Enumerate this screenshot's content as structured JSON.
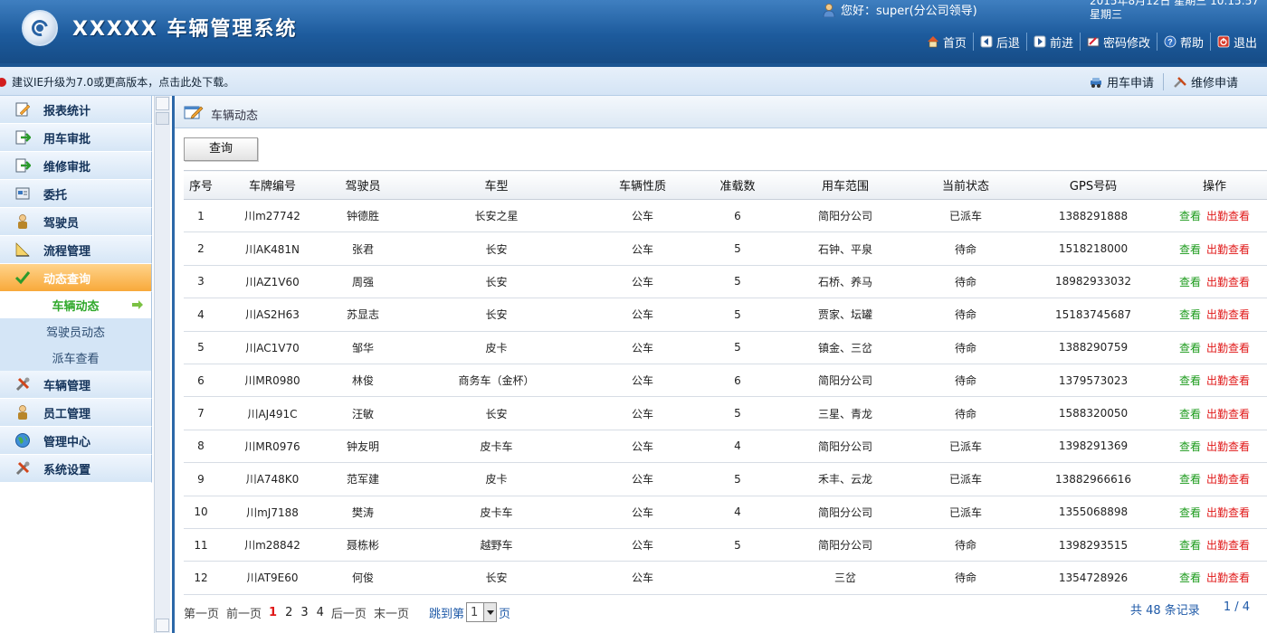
{
  "header": {
    "title": "XXXXX 车辆管理系统",
    "greeting": "您好：super(分公司领导)",
    "datetime_line1": "2015年8月12日 星期三 10:15:57",
    "datetime_line2": "星期三",
    "nav": [
      {
        "label": "首页",
        "icon": "home-icon"
      },
      {
        "label": "后退",
        "icon": "back-icon"
      },
      {
        "label": "前进",
        "icon": "forward-icon"
      },
      {
        "label": "密码修改",
        "icon": "password-icon"
      },
      {
        "label": "帮助",
        "icon": "help-icon"
      },
      {
        "label": "退出",
        "icon": "logout-icon"
      }
    ]
  },
  "notice": {
    "text": "建议IE升级为7.0或更高版本，点击此处下载。",
    "quick_links": [
      {
        "label": "用车申请",
        "icon": "car-apply-icon"
      },
      {
        "label": "维修申请",
        "icon": "repair-apply-icon"
      }
    ]
  },
  "sidebar": {
    "items": [
      {
        "label": "报表统计",
        "icon": "report-icon"
      },
      {
        "label": "用车审批",
        "icon": "approve-icon"
      },
      {
        "label": "维修审批",
        "icon": "approve-icon"
      },
      {
        "label": "委托",
        "icon": "delegate-icon"
      },
      {
        "label": "驾驶员",
        "icon": "driver-icon"
      },
      {
        "label": "流程管理",
        "icon": "flow-icon"
      },
      {
        "label": "动态查询",
        "icon": "check-icon"
      },
      {
        "label": "车辆管理",
        "icon": "tools-icon"
      },
      {
        "label": "员工管理",
        "icon": "driver-icon"
      },
      {
        "label": "管理中心",
        "icon": "globe-icon"
      },
      {
        "label": "系统设置",
        "icon": "tools-icon"
      }
    ],
    "sub_items": [
      {
        "label": "车辆动态"
      },
      {
        "label": "驾驶员动态"
      },
      {
        "label": "派车查看"
      }
    ]
  },
  "content": {
    "breadcrumb": "车辆动态",
    "query_button": "查询",
    "columns": [
      "序号",
      "车牌编号",
      "驾驶员",
      "车型",
      "车辆性质",
      "准载数",
      "用车范围",
      "当前状态",
      "GPS号码",
      "操作"
    ],
    "rows": [
      {
        "no": "1",
        "plate": "川m27742",
        "driver": "钟德胜",
        "model": "长安之星",
        "nature": "公车",
        "seats": "6",
        "scope": "简阳分公司",
        "status": "已派车",
        "gps": "1388291888"
      },
      {
        "no": "2",
        "plate": "川AK481N",
        "driver": "张君",
        "model": "长安",
        "nature": "公车",
        "seats": "5",
        "scope": "石钟、平泉",
        "status": "待命",
        "gps": "1518218000"
      },
      {
        "no": "3",
        "plate": "川AZ1V60",
        "driver": "周强",
        "model": "长安",
        "nature": "公车",
        "seats": "5",
        "scope": "石桥、养马",
        "status": "待命",
        "gps": "18982933032"
      },
      {
        "no": "4",
        "plate": "川AS2H63",
        "driver": "苏显志",
        "model": "长安",
        "nature": "公车",
        "seats": "5",
        "scope": "贾家、坛罐",
        "status": "待命",
        "gps": "15183745687"
      },
      {
        "no": "5",
        "plate": "川AC1V70",
        "driver": "邹华",
        "model": "皮卡",
        "nature": "公车",
        "seats": "5",
        "scope": "镇金、三岔",
        "status": "待命",
        "gps": "1388290759"
      },
      {
        "no": "6",
        "plate": "川MR0980",
        "driver": "林俊",
        "model": "商务车（金杯）",
        "nature": "公车",
        "seats": "6",
        "scope": "简阳分公司",
        "status": "待命",
        "gps": "1379573023"
      },
      {
        "no": "7",
        "plate": "川AJ491C",
        "driver": "汪敏",
        "model": "长安",
        "nature": "公车",
        "seats": "5",
        "scope": "三星、青龙",
        "status": "待命",
        "gps": "1588320050"
      },
      {
        "no": "8",
        "plate": "川MR0976",
        "driver": "钟友明",
        "model": "皮卡车",
        "nature": "公车",
        "seats": "4",
        "scope": "简阳分公司",
        "status": "已派车",
        "gps": "1398291369"
      },
      {
        "no": "9",
        "plate": "川A748K0",
        "driver": "范军建",
        "model": "皮卡",
        "nature": "公车",
        "seats": "5",
        "scope": "禾丰、云龙",
        "status": "已派车",
        "gps": "13882966616"
      },
      {
        "no": "10",
        "plate": "川mJ7188",
        "driver": "樊涛",
        "model": "皮卡车",
        "nature": "公车",
        "seats": "4",
        "scope": "简阳分公司",
        "status": "已派车",
        "gps": "1355068898"
      },
      {
        "no": "11",
        "plate": "川m28842",
        "driver": "聂栋彬",
        "model": "越野车",
        "nature": "公车",
        "seats": "5",
        "scope": "简阳分公司",
        "status": "待命",
        "gps": "1398293515"
      },
      {
        "no": "12",
        "plate": "川AT9E60",
        "driver": "何俊",
        "model": "长安",
        "nature": "公车",
        "seats": "",
        "scope": "三岔",
        "status": "待命",
        "gps": "1354728926"
      }
    ],
    "op_view": "查看",
    "op_attendance": "出勤查看",
    "status_colors": {
      "已派车": "#1d9b1d",
      "待命": "#e01818"
    }
  },
  "pager": {
    "first": "第一页",
    "prev": "前一页",
    "pages": [
      "1",
      "2",
      "3",
      "4"
    ],
    "current_page": "1",
    "next": "后一页",
    "last": "末一页",
    "jump_prefix": "跳到第",
    "jump_value": "1",
    "jump_suffix": "页",
    "total_text": "共 48 条记录",
    "page_info": "1 / 4"
  }
}
